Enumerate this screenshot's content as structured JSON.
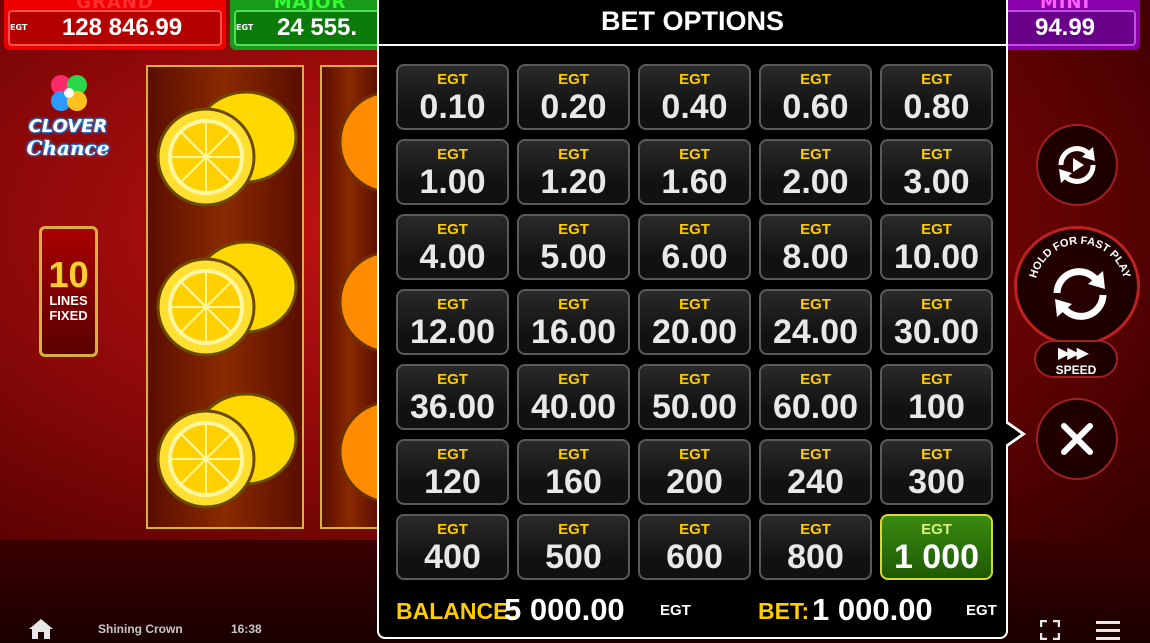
{
  "jackpots": {
    "grand": {
      "label": "GRAND",
      "value": "128 846.99",
      "brand": "EGT"
    },
    "major": {
      "label": "MAJOR",
      "value": "24 555.",
      "brand": "EGT"
    },
    "mini": {
      "label": "MINI",
      "value": "94.99"
    }
  },
  "logo": {
    "line1": "CLOVER",
    "line2": "Chance"
  },
  "lines": {
    "count": "10",
    "line1": "LINES",
    "line2": "FIXED"
  },
  "bet_panel": {
    "title": "BET OPTIONS",
    "currency_tag": "EGT",
    "options": [
      "0.10",
      "0.20",
      "0.40",
      "0.60",
      "0.80",
      "1.00",
      "1.20",
      "1.60",
      "2.00",
      "3.00",
      "4.00",
      "5.00",
      "6.00",
      "8.00",
      "10.00",
      "12.00",
      "16.00",
      "20.00",
      "24.00",
      "30.00",
      "36.00",
      "40.00",
      "50.00",
      "60.00",
      "100",
      "120",
      "160",
      "200",
      "240",
      "300",
      "400",
      "500",
      "600",
      "800",
      "1 000"
    ],
    "selected": "1 000",
    "balance_label": "BALANCE:",
    "balance_value": "5 000.00",
    "balance_unit": "EGT",
    "bet_label": "BET:",
    "bet_value": "1 000.00",
    "bet_unit": "EGT"
  },
  "controls": {
    "hold_text": "HOLD FOR FAST PLAY",
    "speed_label": "SPEED"
  },
  "footer": {
    "game_name": "Shining Crown",
    "time": "16:38"
  },
  "colors": {
    "gold": "#ffcc00",
    "selected_green": "#3a8a10",
    "panel_bg": "#000000"
  }
}
